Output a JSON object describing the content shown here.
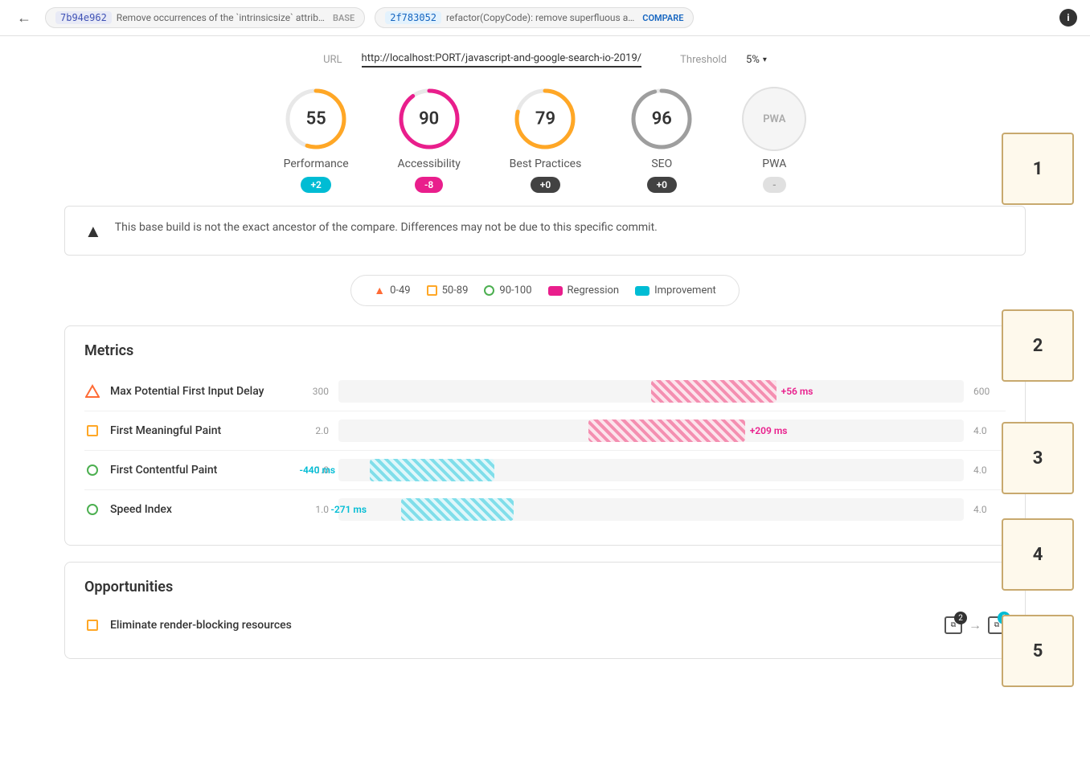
{
  "nav": {
    "back_label": "←",
    "base_hash": "7b94e962",
    "base_desc": "Remove occurrences of the `intrinsicsize` attrib…",
    "base_tag": "BASE",
    "compare_hash": "2f783052",
    "compare_desc": "refactor(CopyCode): remove superfluous a…",
    "compare_tag": "COMPARE",
    "info_label": "i"
  },
  "url_bar": {
    "url_label": "URL",
    "url_value": "http://localhost:PORT/javascript-and-google-search-io-2019/",
    "threshold_label": "Threshold",
    "threshold_value": "5%"
  },
  "scores": [
    {
      "id": "performance",
      "name": "Performance",
      "value": "55",
      "badge": "+2",
      "badge_type": "improvement",
      "stroke_color": "#ffa726",
      "pct": 55
    },
    {
      "id": "accessibility",
      "name": "Accessibility",
      "value": "90",
      "badge": "-8",
      "badge_type": "regression",
      "stroke_color": "#e91e8c",
      "pct": 90
    },
    {
      "id": "best-practices",
      "name": "Best Practices",
      "value": "79",
      "badge": "+0",
      "badge_type": "neutral",
      "stroke_color": "#ffa726",
      "pct": 79
    },
    {
      "id": "seo",
      "name": "SEO",
      "value": "96",
      "badge": "+0",
      "badge_type": "neutral",
      "stroke_color": "#9e9e9e",
      "pct": 96
    },
    {
      "id": "pwa",
      "name": "PWA",
      "value": "PWA",
      "badge": "-",
      "badge_type": "dash",
      "is_pwa": true
    }
  ],
  "warning": {
    "text": "This base build is not the exact ancestor of the compare. Differences may not be due to this specific commit."
  },
  "legend": {
    "items": [
      {
        "icon": "triangle",
        "range": "0-49"
      },
      {
        "icon": "square-orange",
        "range": "50-89"
      },
      {
        "icon": "circle-green",
        "range": "90-100"
      },
      {
        "icon": "rect-pink",
        "label": "Regression"
      },
      {
        "icon": "rect-cyan",
        "label": "Improvement"
      }
    ]
  },
  "metrics": {
    "title": "Metrics",
    "rows": [
      {
        "name": "Max Potential First Input Delay",
        "icon": "triangle",
        "icon_color": "#ff6b35",
        "min": "300",
        "max": "600",
        "bar_type": "regression",
        "bar_left_pct": 50,
        "bar_width_pct": 20,
        "bar_label": "+56 ms"
      },
      {
        "name": "First Meaningful Paint",
        "icon": "square",
        "icon_color": "#ffa726",
        "min": "2.0",
        "max": "4.0",
        "bar_type": "regression",
        "bar_left_pct": 40,
        "bar_width_pct": 25,
        "bar_label": "+209 ms"
      },
      {
        "name": "First Contentful Paint",
        "icon": "circle",
        "icon_color": "#4caf50",
        "min": "1.0",
        "max": "4.0",
        "bar_type": "improvement",
        "bar_left_pct": 25,
        "bar_width_pct": 20,
        "bar_label": "-440 ms"
      },
      {
        "name": "Speed Index",
        "icon": "circle",
        "icon_color": "#4caf50",
        "min": "1.0",
        "max": "4.0",
        "bar_type": "improvement",
        "bar_left_pct": 28,
        "bar_width_pct": 18,
        "bar_label": "-271 ms"
      }
    ]
  },
  "opportunities": {
    "title": "Opportunities",
    "rows": [
      {
        "name": "Eliminate render-blocking resources",
        "icon": "square",
        "icon_color": "#ffa726",
        "base_count": 2,
        "compare_count": 1
      }
    ]
  },
  "annotations": [
    {
      "id": "ann1",
      "number": "1"
    },
    {
      "id": "ann2",
      "number": "2"
    },
    {
      "id": "ann3",
      "number": "3"
    },
    {
      "id": "ann4",
      "number": "4"
    },
    {
      "id": "ann5",
      "number": "5"
    }
  ]
}
